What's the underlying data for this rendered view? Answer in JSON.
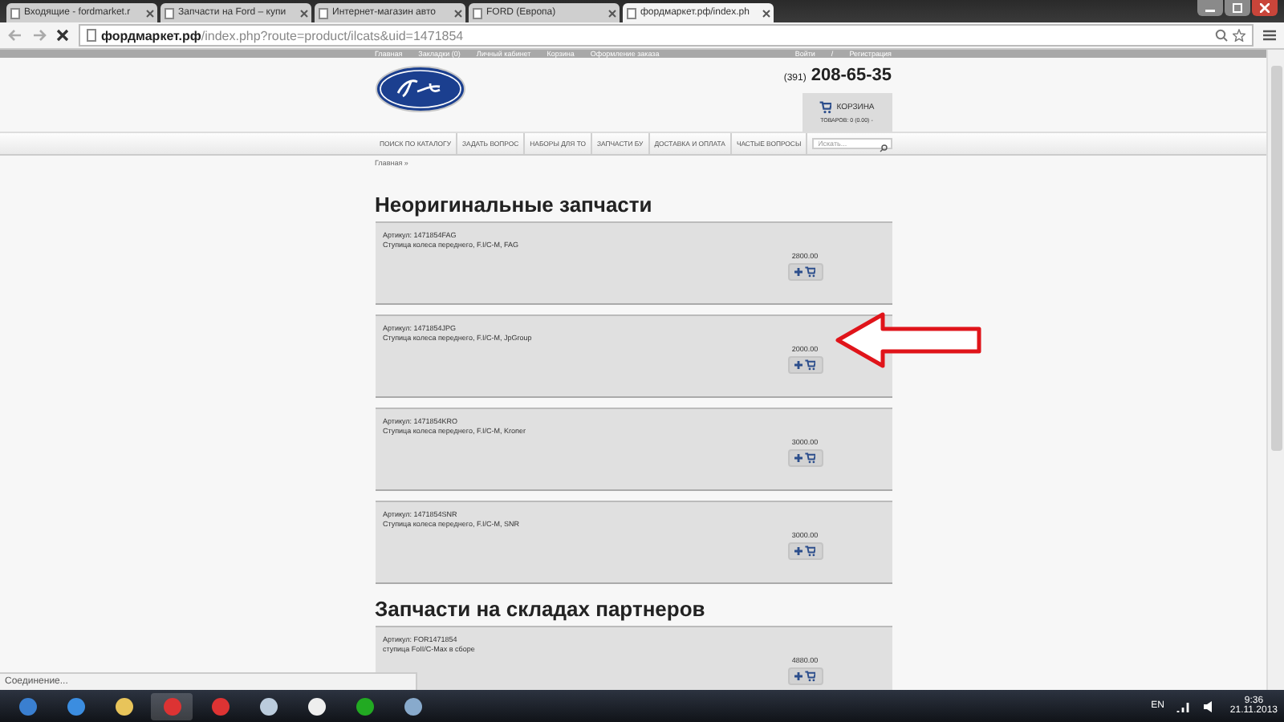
{
  "browser": {
    "tabs": [
      {
        "label": "Входящие - fordmarket.r",
        "selected": false
      },
      {
        "label": "Запчасти на Ford – купи",
        "selected": false
      },
      {
        "label": "Интернет-магазин авто",
        "selected": false
      },
      {
        "label": "FORD (Европа)",
        "selected": false
      },
      {
        "label": "фордмаркет.рф/index.ph",
        "selected": true
      }
    ],
    "address": "**фордмаркет.рф**/index.php?route=product/ilcats&uid=1471854",
    "status": "Соединение..."
  },
  "site": {
    "top_links": [
      "Главная",
      "Закладки (0)",
      "Личный кабинет",
      "Корзина",
      "Оформление заказа"
    ],
    "account_links": [
      "Войти",
      "/",
      "Регистрация"
    ],
    "phone_code": "(391)",
    "phone": "208-65-35",
    "cart": {
      "title": "КОРЗИНА",
      "summary": "ТОВАРОВ: 0 (0.00) -"
    },
    "menu": [
      "ПОИСК ПО КАТАЛОГУ",
      "ЗАДАТЬ ВОПРОС",
      "НАБОРЫ ДЛЯ ТО",
      "ЗАПЧАСТИ БУ",
      "ДОСТАВКА И ОПЛАТА",
      "ЧАСТЫЕ ВОПРОСЫ"
    ],
    "search": {
      "placeholder": "Искать..."
    },
    "breadcrumb": "Главная »",
    "sections": [
      {
        "title": "Неоригинальные запчасти",
        "items": [
          {
            "article": "Артикул: 1471854FAG",
            "description": "Ступица колеса переднего, F.I/C-M, FAG",
            "price": "2800.00"
          },
          {
            "article": "Артикул: 1471854JPG",
            "description": "Ступица колеса переднего, F.I/C-M, JpGroup",
            "price": "2000.00"
          },
          {
            "article": "Артикул: 1471854KRO",
            "description": "Ступица колеса переднего, F.I/C-M, Kroner",
            "price": "3000.00"
          },
          {
            "article": "Артикул: 1471854SNR",
            "description": "Ступица колеса переднего, F.I/C-M, SNR",
            "price": "3000.00"
          }
        ]
      },
      {
        "title": "Запчасти на складах партнеров",
        "items": [
          {
            "article": "Артикул: FOR1471854",
            "description": "ступица FoII/C-Max в сборе",
            "price": "4880.00"
          }
        ]
      }
    ]
  },
  "taskbar": {
    "language": "EN",
    "time": "9:36",
    "date": "21.11.2013"
  }
}
